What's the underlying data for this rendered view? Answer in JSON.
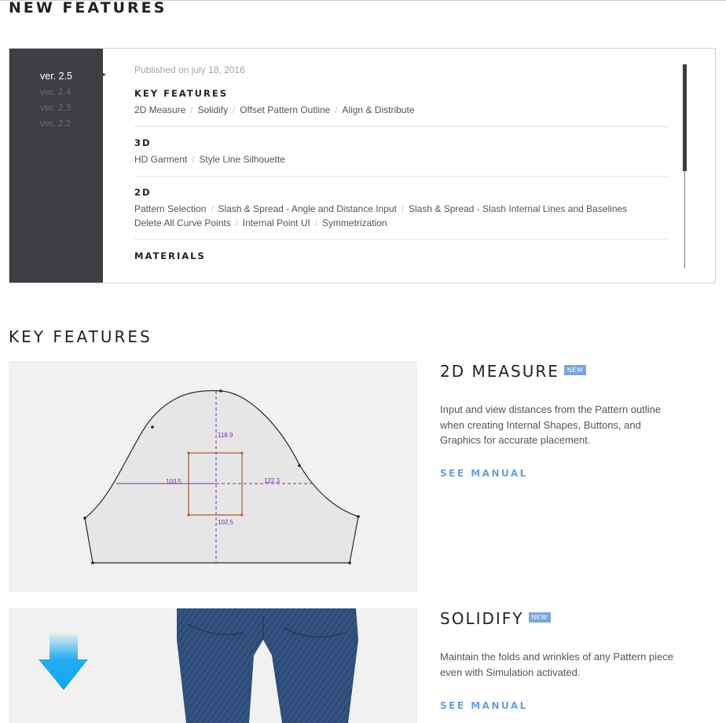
{
  "new_features": {
    "title": "NEW FEATURES",
    "versions": [
      "ver. 2.5",
      "ver. 2.4",
      "ver. 2.3",
      "ver. 2.2"
    ],
    "active_version": "ver. 2.5",
    "published": "Published on july 18, 2016",
    "sections": [
      {
        "heading": "KEY FEATURES",
        "items": [
          "2D Measure",
          "Solidify",
          "Offset Pattern Outline",
          "Align & Distribute"
        ]
      },
      {
        "heading": "3D",
        "items": [
          "HD Garment",
          "Style Line Silhouette"
        ]
      },
      {
        "heading": "2D",
        "items": [
          "Pattern Selection",
          "Slash & Spread - Angle and Distance Input",
          "Slash & Spread - Slash Internal Lines and Baselines"
        ],
        "items2": [
          "Delete All Curve Points",
          "Internal Point UI",
          "Symmetrization"
        ]
      },
      {
        "heading": "MATERIALS",
        "items": []
      }
    ]
  },
  "key_features": {
    "title": "KEY FEATURES",
    "features": [
      {
        "title": "2D MEASURE",
        "badge": "NEW",
        "description": "Input and view distances from the Pattern outline when creating Internal Shapes, Buttons, and Graphics for accurate placement.",
        "link": "SEE MANUAL",
        "measurements": [
          "118.9",
          "103.5",
          "122.3",
          "102.5"
        ]
      },
      {
        "title": "SOLIDIFY",
        "badge": "NEW",
        "description": "Maintain the folds and wrinkles of any Pattern piece even with Simulation activated.",
        "link": "SEE MANUAL"
      }
    ]
  },
  "colors": {
    "version_panel": "#3f3f43",
    "badge": "#7aa6d9",
    "link": "#6f9ed6",
    "measure_line": "#7a2fb0",
    "rectangle": "#a9542b",
    "arrow": "#0ea6f2",
    "fabric": "#2e4c78"
  }
}
